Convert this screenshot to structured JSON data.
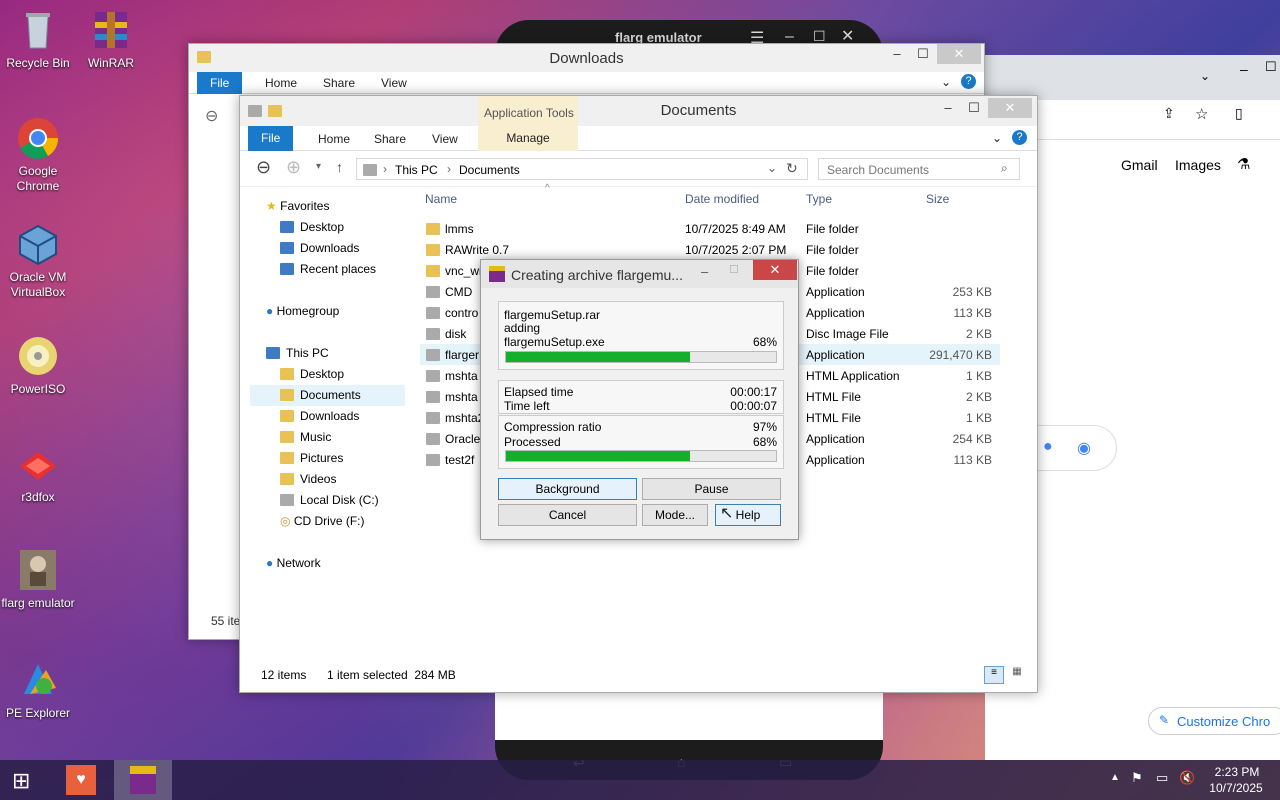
{
  "desktop_icons": [
    {
      "label": "Recycle Bin",
      "icon": "recycle-bin-icon"
    },
    {
      "label": "WinRAR",
      "icon": "winrar-icon"
    },
    {
      "label": "Google Chrome",
      "icon": "chrome-icon"
    },
    {
      "label": "Oracle VM VirtualBox",
      "icon": "virtualbox-icon"
    },
    {
      "label": "PowerISO",
      "icon": "poweriso-icon"
    },
    {
      "label": "r3dfox",
      "icon": "r3dfox-icon"
    },
    {
      "label": "flarg emulator",
      "icon": "flarg-emulator-icon"
    },
    {
      "label": "PE Explorer",
      "icon": "pe-explorer-icon"
    }
  ],
  "emulator": {
    "title": "flarg emulator"
  },
  "chrome": {
    "gmail": "Gmail",
    "images": "Images",
    "customize": "Customize Chro"
  },
  "downloads_window": {
    "title": "Downloads",
    "tabs": [
      "File",
      "Home",
      "Share",
      "View"
    ],
    "status": "55 ite"
  },
  "documents_window": {
    "title": "Documents",
    "context_tab_group": "Application Tools",
    "context_tab": "Manage",
    "tabs": [
      "File",
      "Home",
      "Share",
      "View"
    ],
    "breadcrumb": [
      "This PC",
      "Documents"
    ],
    "search_placeholder": "Search Documents",
    "nav": {
      "favorites": "Favorites",
      "fav_items": [
        "Desktop",
        "Downloads",
        "Recent places"
      ],
      "homegroup": "Homegroup",
      "thispc": "This PC",
      "pc_items": [
        "Desktop",
        "Documents",
        "Downloads",
        "Music",
        "Pictures",
        "Videos",
        "Local Disk (C:)",
        "CD Drive (F:)"
      ],
      "network": "Network"
    },
    "columns": [
      "Name",
      "Date modified",
      "Type",
      "Size"
    ],
    "files": [
      {
        "name": "lmms",
        "date": "10/7/2025 8:49 AM",
        "type": "File folder",
        "size": ""
      },
      {
        "name": "RAWrite 0.7",
        "date": "10/7/2025 2:07 PM",
        "type": "File folder",
        "size": ""
      },
      {
        "name": "vnc_wi",
        "date": "",
        "type": "File folder",
        "size": ""
      },
      {
        "name": "CMD",
        "date": "",
        "type": "Application",
        "size": "253 KB"
      },
      {
        "name": "contro",
        "date": "",
        "type": "Application",
        "size": "113 KB"
      },
      {
        "name": "disk",
        "date": "",
        "type": "Disc Image File",
        "size": "2 KB"
      },
      {
        "name": "flarger",
        "date": "",
        "type": "Application",
        "size": "291,470 KB"
      },
      {
        "name": "mshta",
        "date": "",
        "type": "HTML Application",
        "size": "1 KB"
      },
      {
        "name": "mshta",
        "date": "",
        "type": "HTML File",
        "size": "2 KB"
      },
      {
        "name": "mshta2",
        "date": "",
        "type": "HTML File",
        "size": "1 KB"
      },
      {
        "name": "Oracle",
        "date": "",
        "type": "Application",
        "size": "254 KB"
      },
      {
        "name": "test2f",
        "date": "",
        "type": "Application",
        "size": "113 KB"
      }
    ],
    "status_items": "12 items",
    "status_selected": "1 item selected  284 MB"
  },
  "winrar_dialog": {
    "title": "Creating archive flargemu...",
    "archive": "flargemuSetup.rar",
    "action": "adding",
    "file": "flargemuSetup.exe",
    "file_pct": "68%",
    "file_progress": 0.68,
    "elapsed_label": "Elapsed time",
    "elapsed": "00:00:17",
    "left_label": "Time left",
    "left": "00:00:07",
    "ratio_label": "Compression ratio",
    "ratio": "97%",
    "processed_label": "Processed",
    "processed": "68%",
    "processed_progress": 0.68,
    "buttons": {
      "background": "Background",
      "pause": "Pause",
      "cancel": "Cancel",
      "mode": "Mode...",
      "help": "Help"
    }
  },
  "taskbar": {
    "time": "2:23 PM",
    "date": "10/7/2025"
  }
}
